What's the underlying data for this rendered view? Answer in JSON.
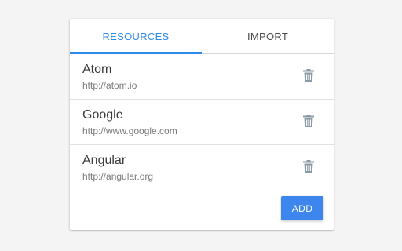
{
  "tabs": [
    {
      "label": "RESOURCES",
      "active": true
    },
    {
      "label": "IMPORT",
      "active": false
    }
  ],
  "resources": [
    {
      "name": "Atom",
      "url": "http://atom.io",
      "icon": "trash-icon"
    },
    {
      "name": "Google",
      "url": "http://www.google.com",
      "icon": "trash-icon"
    },
    {
      "name": "Angular",
      "url": "http://angular.org",
      "icon": "trash-icon"
    }
  ],
  "actions": {
    "add_label": "ADD"
  },
  "colors": {
    "accent": "#2f8bea",
    "button": "#3d86ee",
    "icon": "#8a9aa4"
  }
}
